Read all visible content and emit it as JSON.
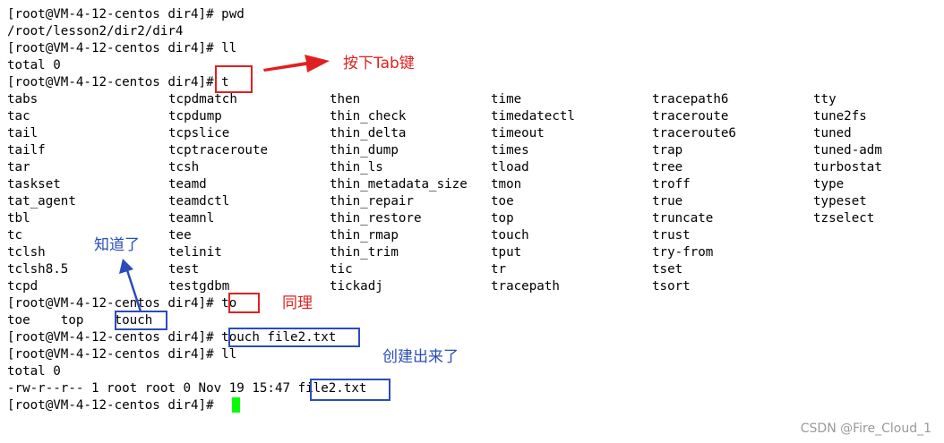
{
  "terminal": {
    "lines": [
      "[root@VM-4-12-centos dir4]# pwd",
      "/root/lesson2/dir2/dir4",
      "[root@VM-4-12-centos dir4]# ll",
      "total 0",
      "[root@VM-4-12-centos dir4]# t"
    ],
    "completion_columns": [
      [
        "tabs",
        "tac",
        "tail",
        "tailf",
        "tar",
        "taskset",
        "tat_agent",
        "tbl",
        "tc",
        "tclsh",
        "tclsh8.5",
        "tcpd"
      ],
      [
        "tcpdmatch",
        "tcpdump",
        "tcpslice",
        "tcptraceroute",
        "tcsh",
        "teamd",
        "teamdctl",
        "teamnl",
        "tee",
        "telinit",
        "test",
        "testgdbm"
      ],
      [
        "then",
        "thin_check",
        "thin_delta",
        "thin_dump",
        "thin_ls",
        "thin_metadata_size",
        "thin_repair",
        "thin_restore",
        "thin_rmap",
        "thin_trim",
        "tic",
        "tickadj"
      ],
      [
        "time",
        "timedatectl",
        "timeout",
        "times",
        "tload",
        "tmon",
        "toe",
        "top",
        "touch",
        "tput",
        "tr",
        "tracepath"
      ],
      [
        "tracepath6",
        "traceroute",
        "traceroute6",
        "trap",
        "tree",
        "troff",
        "true",
        "truncate",
        "trust",
        "try-from",
        "tset",
        "tsort"
      ],
      [
        "tty",
        "tune2fs",
        "tuned",
        "tuned-adm",
        "turbostat",
        "type",
        "typeset",
        "tzselect"
      ]
    ],
    "lines_after": [
      "[root@VM-4-12-centos dir4]# to",
      "toe    top    touch",
      "[root@VM-4-12-centos dir4]# touch file2.txt",
      "[root@VM-4-12-centos dir4]# ll",
      "total 0",
      "-rw-r--r-- 1 root root 0 Nov 19 15:47 file2.txt",
      "[root@VM-4-12-centos dir4]# "
    ],
    "cursor_color": "#00ff00"
  },
  "annotations": {
    "press_tab": "按下Tab键",
    "know_it": "知道了",
    "same_idea": "同理",
    "created": "创建出来了",
    "red": "#e02020",
    "blue": "#2a4db8"
  },
  "watermark": "CSDN @Fire_Cloud_1"
}
